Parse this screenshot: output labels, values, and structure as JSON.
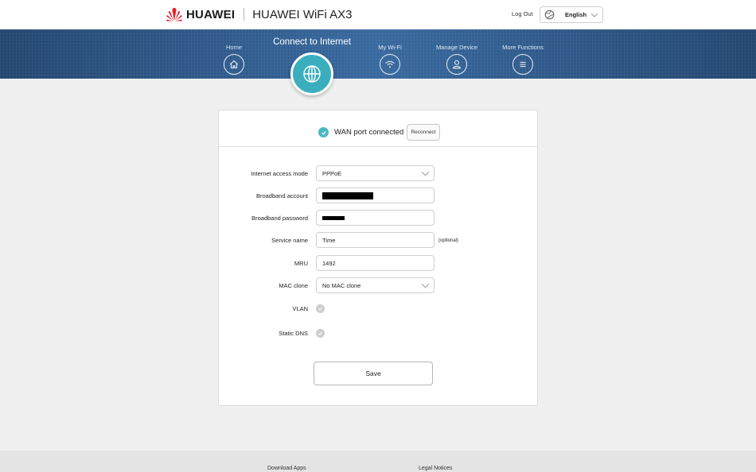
{
  "header": {
    "brand": "HUAWEI",
    "product": "HUAWEI WiFi AX3",
    "logout_label": "Log Out",
    "language": "English",
    "brand_color": "#e3202d"
  },
  "nav": {
    "items": [
      {
        "label": "Home",
        "icon": "home-icon"
      },
      {
        "label": "Connect to Internet",
        "icon": "globe-icon",
        "active": true
      },
      {
        "label": "My Wi-Fi",
        "icon": "wifi-icon"
      },
      {
        "label": "Manage Device",
        "icon": "user-icon"
      },
      {
        "label": "More Functions",
        "icon": "menu-icon"
      }
    ],
    "accent_color": "#3aaebd",
    "banner_color": "#2e5d94"
  },
  "status": {
    "text": "WAN port connected",
    "reconnect_label": "Reconnect"
  },
  "form": {
    "internet_access_mode": {
      "label": "Internet access mode",
      "value": "PPPoE"
    },
    "broadband_account": {
      "label": "Broadband account"
    },
    "broadband_password": {
      "label": "Broadband password"
    },
    "service_name": {
      "label": "Service name",
      "value": "Time",
      "hint": "(optional)"
    },
    "mru": {
      "label": "MRU",
      "value": "1492"
    },
    "mac_clone": {
      "label": "MAC clone",
      "value": "No MAC clone"
    },
    "vlan": {
      "label": "VLAN"
    },
    "static_dns": {
      "label": "Static DNS"
    },
    "save_label": "Save"
  },
  "footer": {
    "download_apps": "Download Apps",
    "legal_notices": "Legal Notices"
  }
}
